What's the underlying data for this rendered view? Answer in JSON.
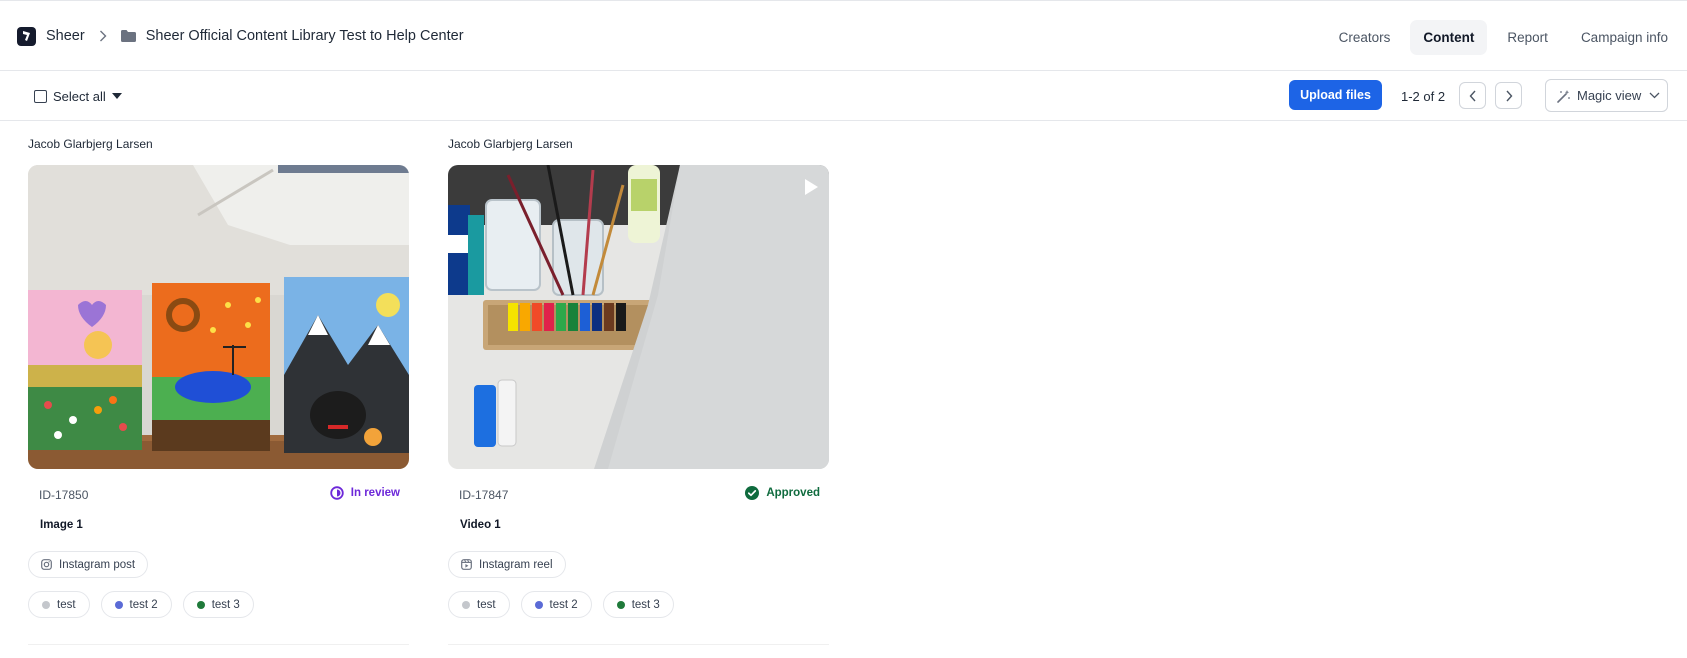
{
  "header": {
    "brand": "Sheer",
    "folder_title": "Sheer Official Content Library Test to Help Center",
    "tabs": [
      {
        "label": "Creators",
        "active": false
      },
      {
        "label": "Content",
        "active": true
      },
      {
        "label": "Report",
        "active": false
      },
      {
        "label": "Campaign info",
        "active": false
      }
    ]
  },
  "toolbar": {
    "select_all_label": "Select all",
    "upload_label": "Upload files",
    "pagination": "1-2 of 2",
    "magic_view_label": "Magic view"
  },
  "colors": {
    "primary": "#1d64e6",
    "in_review": "#6d28d9",
    "approved": "#0f6b3e"
  },
  "cards": [
    {
      "creator": "Jacob Glarbjerg Larsen",
      "media_type": "image",
      "id": "ID-17850",
      "status": "In review",
      "title": "Image 1",
      "format": "Instagram post",
      "format_icon": "instagram-icon",
      "tags": [
        {
          "label": "test",
          "color": "#c4c7cc"
        },
        {
          "label": "test 2",
          "color": "#5b6bd6"
        },
        {
          "label": "test 3",
          "color": "#1f7a3a"
        }
      ]
    },
    {
      "creator": "Jacob Glarbjerg Larsen",
      "media_type": "video",
      "id": "ID-17847",
      "status": "Approved",
      "title": "Video 1",
      "format": "Instagram reel",
      "format_icon": "reel-icon",
      "tags": [
        {
          "label": "test",
          "color": "#c4c7cc"
        },
        {
          "label": "test 2",
          "color": "#5b6bd6"
        },
        {
          "label": "test 3",
          "color": "#1f7a3a"
        }
      ]
    }
  ]
}
